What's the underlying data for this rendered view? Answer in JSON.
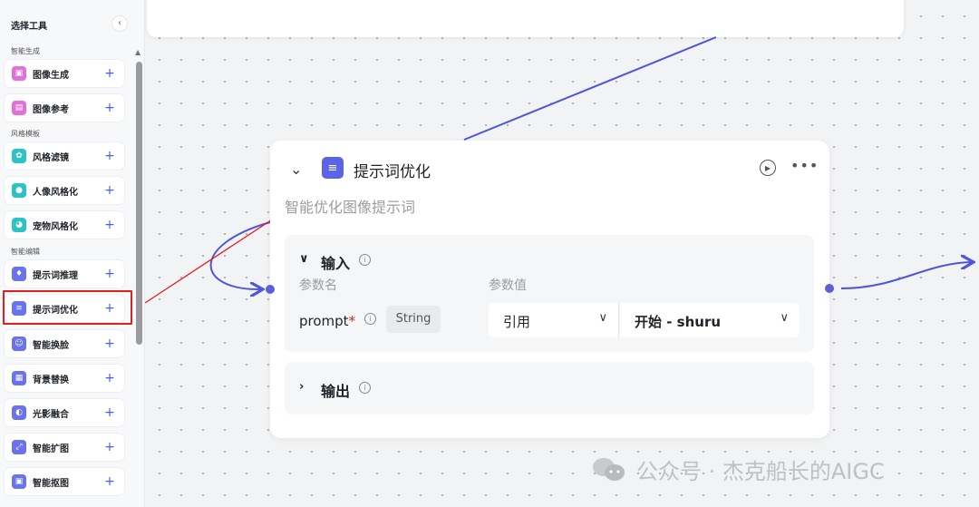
{
  "sidebar": {
    "title": "选择工具",
    "collapse_glyph": "‹",
    "groups": [
      {
        "title": "智能生成"
      },
      {
        "title": "风格模板"
      },
      {
        "title": "智能编辑"
      }
    ],
    "items": [
      {
        "label": "图像生成",
        "icon": "image-icon",
        "color": "#e36fd9"
      },
      {
        "label": "图像参考",
        "icon": "image-reference-icon",
        "color": "#e36fd9"
      },
      {
        "label": "风格滤镜",
        "icon": "style-filter-icon",
        "color": "#2cc3c7"
      },
      {
        "label": "人像风格化",
        "icon": "portrait-icon",
        "color": "#2cc3c7"
      },
      {
        "label": "宠物风格化",
        "icon": "pet-icon",
        "color": "#2cc3c7"
      },
      {
        "label": "提示词推理",
        "icon": "bulb-icon",
        "color": "#6a73ee"
      },
      {
        "label": "提示词优化",
        "icon": "list-icon",
        "color": "#6a73ee"
      },
      {
        "label": "智能换脸",
        "icon": "face-icon",
        "color": "#6a73ee"
      },
      {
        "label": "背景替换",
        "icon": "background-icon",
        "color": "#6a73ee"
      },
      {
        "label": "光影融合",
        "icon": "light-icon",
        "color": "#6a73ee"
      },
      {
        "label": "智能扩图",
        "icon": "expand-icon",
        "color": "#6a73ee"
      },
      {
        "label": "智能抠图",
        "icon": "cutout-icon",
        "color": "#6a73ee"
      }
    ],
    "plus": "+"
  },
  "node": {
    "title": "提示词优化",
    "description": "智能优化图像提示词",
    "accent": "#5b63e6",
    "input_section": {
      "title": "输入",
      "col_name": "参数名",
      "col_value": "参数值",
      "param": {
        "name": "prompt",
        "required": "*",
        "type": "String"
      },
      "ref_select": "引用",
      "source_select": "开始 - shuru"
    },
    "output_section": {
      "title": "输出"
    }
  },
  "watermark": "公众号 · 杰克船长的AIGC",
  "colors": {
    "edge": "#4f55d8",
    "annotation": "#e02020"
  }
}
